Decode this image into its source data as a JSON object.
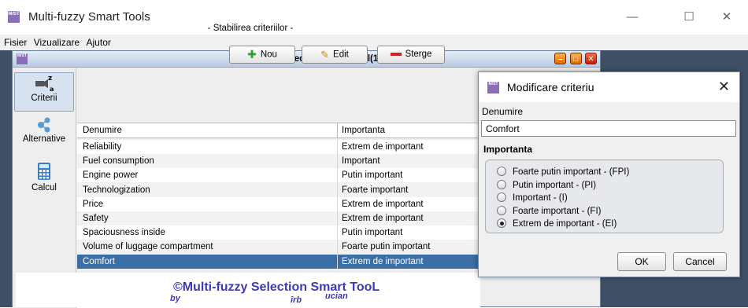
{
  "app": {
    "logo_text": "M/ST",
    "title": "Multi-fuzzy Smart Tools"
  },
  "window_controls": {
    "minimize": "—",
    "maximize": "☐",
    "close": "✕"
  },
  "menu": [
    "Fisier",
    "Vizualizare",
    "Ajutor"
  ],
  "frame": {
    "title": "Multi-fuzzy Selection Smart Tool(1)",
    "logo_text": "M/ST"
  },
  "sidebar": {
    "items": [
      {
        "label": "Criterii",
        "icon": "criteria-icon",
        "active": true
      },
      {
        "label": "Alternative",
        "icon": "share-nodes-icon",
        "active": false
      },
      {
        "label": "Calcul",
        "icon": "calculator-icon",
        "active": false
      }
    ]
  },
  "main": {
    "heading": "- Stabilirea criteriilor -",
    "toolbar": {
      "new_label": "Nou",
      "edit_label": "Edit",
      "delete_label": "Sterge"
    },
    "table": {
      "columns": [
        "Denumire",
        "Importanta"
      ],
      "rows": [
        [
          "Reliability",
          "Extrem de important"
        ],
        [
          "Fuel consumption",
          "Important"
        ],
        [
          "Engine power",
          "Putin important"
        ],
        [
          "Technologization",
          "Foarte important"
        ],
        [
          "Price",
          "Extrem de important"
        ],
        [
          "Safety",
          "Extrem de important"
        ],
        [
          "Spaciousness inside",
          "Putin important"
        ],
        [
          "Volume of luggage compartment",
          "Foarte putin important"
        ],
        [
          "Comfort",
          "Extrem de important"
        ]
      ],
      "selected_index": 8
    }
  },
  "footer": {
    "main": "©Multi-fuzzy Selection Smart TooL",
    "by": "by",
    "irb": "îrb",
    "ucian": "ucian"
  },
  "dialog": {
    "title": "Modificare criteriu",
    "name_label": "Denumire",
    "name_value": "Comfort",
    "importance_label": "Importanta",
    "options": [
      "Foarte putin important - (FPI)",
      "Putin important - (PI)",
      "Important - (I)",
      "Foarte important - (FI)",
      "Extrem de important - (EI)"
    ],
    "selected_option": 4,
    "ok_label": "OK",
    "cancel_label": "Cancel"
  },
  "colors": {
    "selection": "#3a6ea5",
    "footer_text": "#3d3ab5",
    "desktop_bg": "#3f5066",
    "delete_red": "#d32020",
    "add_green": "#2aa22a"
  }
}
